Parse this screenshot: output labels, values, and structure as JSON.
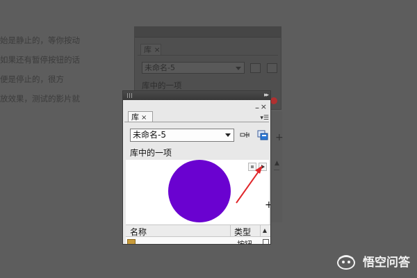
{
  "background_text": [
    "始是静止的，等你按动",
    "如果还有暂停按钮的话",
    "便是停止的，很方",
    "放效果，测试的影片就"
  ],
  "ghost_panel": {
    "tab_label": "库",
    "tab_close": "×",
    "document_select": "未命名-5",
    "items_label": "库中的一项"
  },
  "library_panel": {
    "collapse": "▸▸",
    "tab_label": "库",
    "tab_close": "×",
    "minimize": "–",
    "close": "×",
    "panel_menu": "▾☰",
    "document_select": "未命名-5",
    "items_label": "库中的一项",
    "preview": {
      "symbol_color": "#6a02d0",
      "stop_icon": "stop-icon",
      "play_icon": "play-icon",
      "annotation_color": "#e0262a",
      "plus": "+"
    },
    "list": {
      "col_name": "名称",
      "col_type": "类型",
      "sort": "▲",
      "rows": [
        {
          "name": "...",
          "type": "按钮"
        }
      ]
    }
  },
  "watermark": {
    "text": "悟空问答"
  }
}
